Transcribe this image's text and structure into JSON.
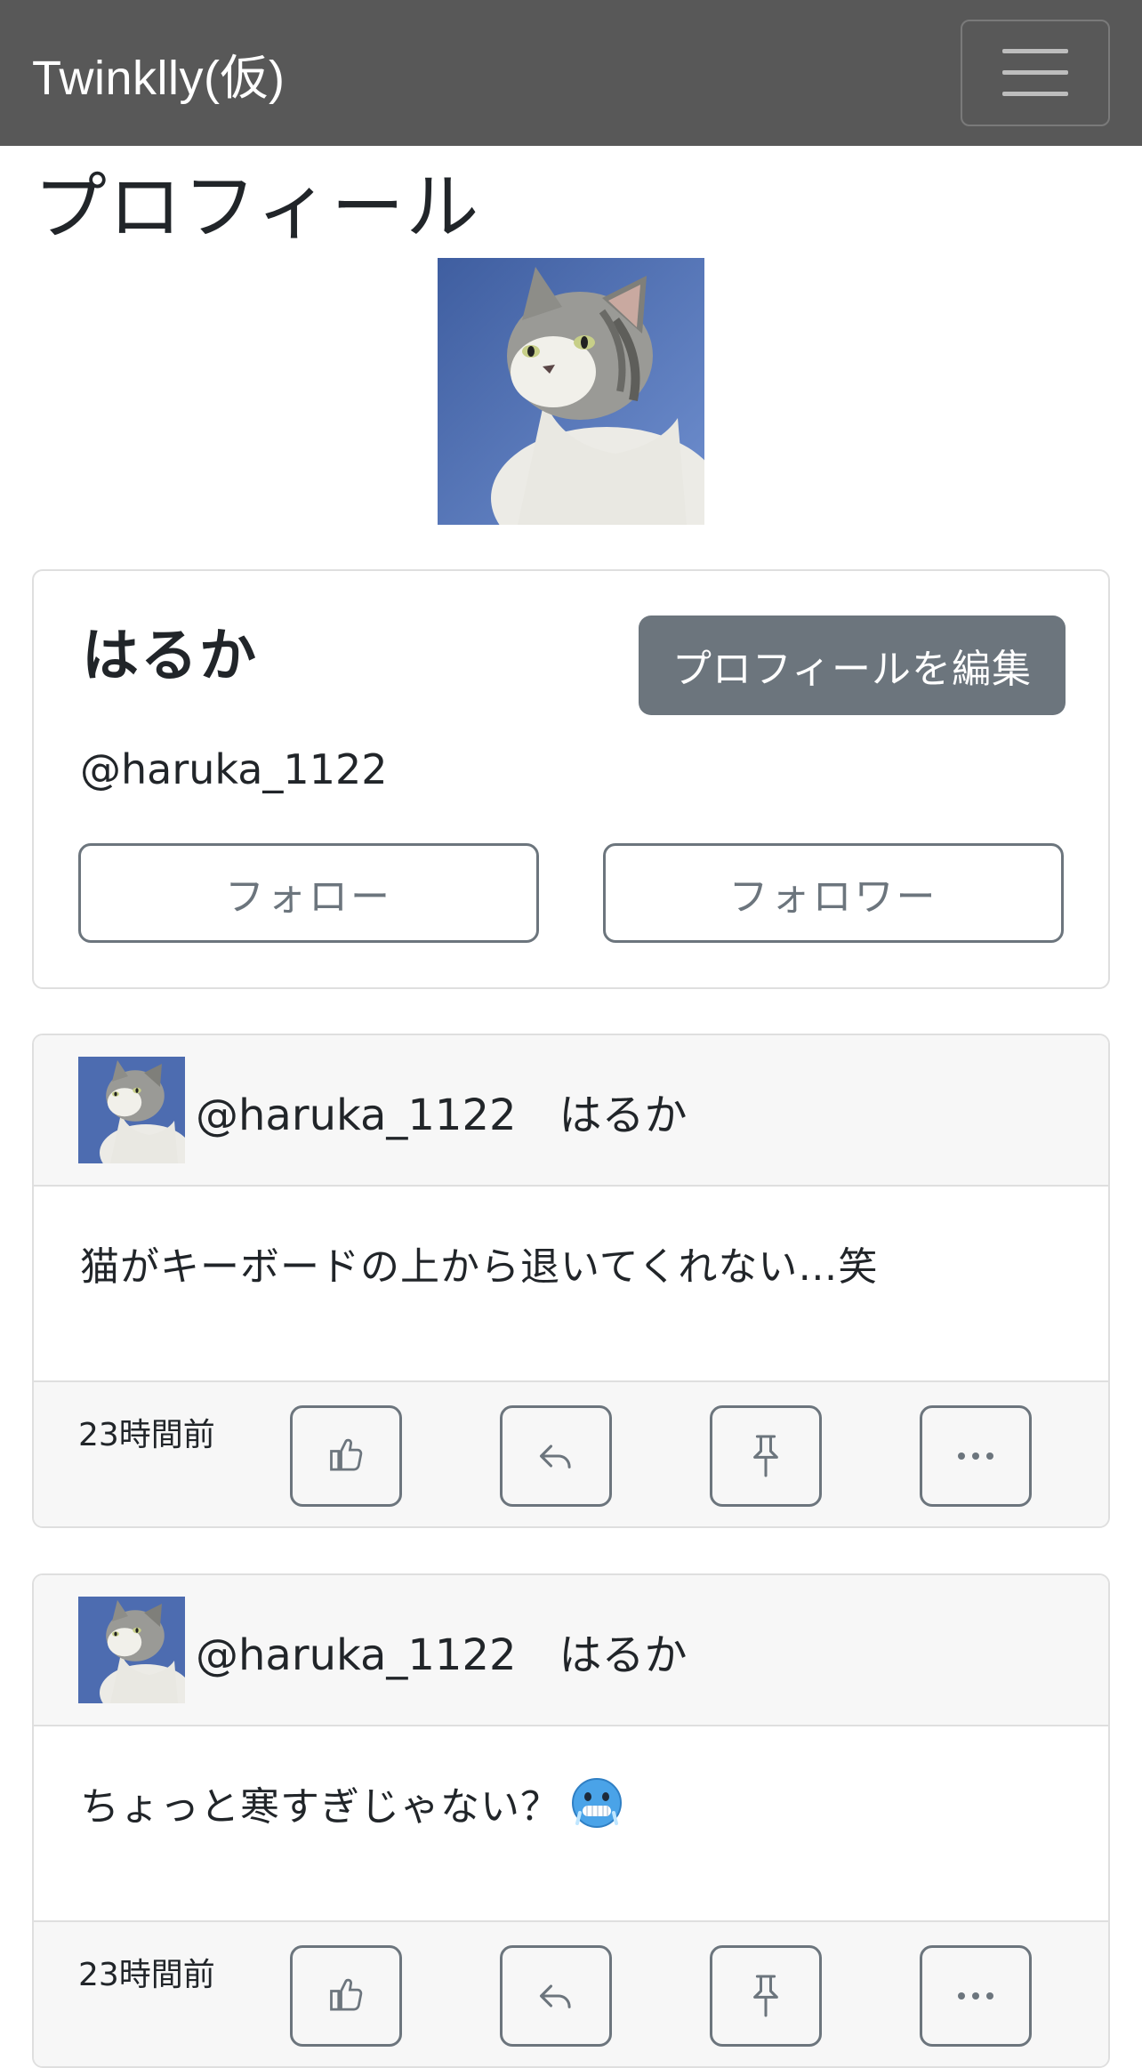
{
  "navbar": {
    "brand": "Twinklly(仮)",
    "menu_icon": "hamburger-icon"
  },
  "page": {
    "title": "プロフィール"
  },
  "profile": {
    "avatar_icon": "cat-photo",
    "name": "はるか",
    "edit_label": "プロフィールを編集",
    "handle": "@haruka_1122",
    "follow_label": "フォロー",
    "follower_label": "フォロワー"
  },
  "posts": [
    {
      "user_line": "@haruka_1122　はるか",
      "text": "猫がキーボードの上から退いてくれない…笑",
      "emoji_icon": "",
      "time": "23時間前",
      "actions": [
        "thumbs-up-icon",
        "reply-icon",
        "pin-icon",
        "more-icon"
      ]
    },
    {
      "user_line": "@haruka_1122　はるか",
      "text": "ちょっと寒すぎじゃない？",
      "emoji_icon": "cold-face-emoji-icon",
      "time": "23時間前",
      "actions": [
        "thumbs-up-icon",
        "reply-icon",
        "pin-icon",
        "more-icon"
      ]
    }
  ],
  "colors": {
    "navbar": "#585858",
    "secondary": "#6c757d",
    "card_header": "#f7f7f7",
    "border": "#dfdfdf"
  }
}
